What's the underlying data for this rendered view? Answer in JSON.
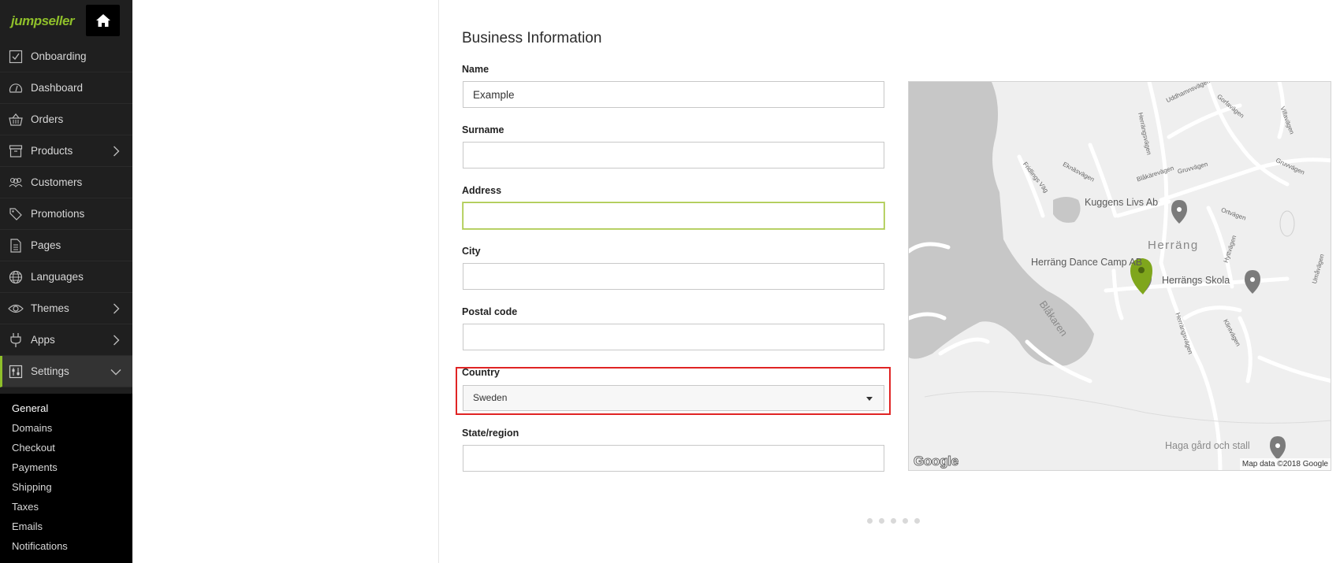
{
  "app": {
    "logo_text": "jumpseller",
    "brand_color": "#8fbf2a"
  },
  "sidebar": {
    "items": [
      {
        "label": "Onboarding",
        "icon": "checkbox-icon",
        "has_children": false
      },
      {
        "label": "Dashboard",
        "icon": "gauge-icon",
        "has_children": false
      },
      {
        "label": "Orders",
        "icon": "basket-icon",
        "has_children": false
      },
      {
        "label": "Products",
        "icon": "box-icon",
        "has_children": true
      },
      {
        "label": "Customers",
        "icon": "people-icon",
        "has_children": false
      },
      {
        "label": "Promotions",
        "icon": "tags-icon",
        "has_children": false
      },
      {
        "label": "Pages",
        "icon": "document-icon",
        "has_children": false
      },
      {
        "label": "Languages",
        "icon": "globe-icon",
        "has_children": false
      },
      {
        "label": "Themes",
        "icon": "eye-icon",
        "has_children": true
      },
      {
        "label": "Apps",
        "icon": "plug-icon",
        "has_children": true
      },
      {
        "label": "Settings",
        "icon": "settings-icon",
        "has_children": true,
        "expanded": true
      }
    ],
    "subitems": [
      "General",
      "Domains",
      "Checkout",
      "Payments",
      "Shipping",
      "Taxes",
      "Emails",
      "Notifications"
    ],
    "current_subitem": "General"
  },
  "form": {
    "title": "Business Information",
    "fields": {
      "name": {
        "label": "Name",
        "value": "Example"
      },
      "surname": {
        "label": "Surname",
        "value": ""
      },
      "address": {
        "label": "Address",
        "value": ""
      },
      "city": {
        "label": "City",
        "value": ""
      },
      "postal_code": {
        "label": "Postal code",
        "value": ""
      },
      "country": {
        "label": "Country",
        "value": "Sweden"
      },
      "state": {
        "label": "State/region",
        "value": ""
      }
    }
  },
  "map": {
    "places": {
      "kuggens": "Kuggens Livs Ab",
      "herrang": "Herräng",
      "dance_camp": "Herräng Dance Camp AB",
      "skola": "Herrängs Skola",
      "haga": "Haga gård och stall",
      "lake": "Blåkaren"
    },
    "roads": {
      "herrangsvagen_top": "Herrängsvägen",
      "herrangsvagen_bottom": "Herrängsvägen",
      "uddhammsvagen": "Uddhamnsvägen",
      "gorfavagen": "Gorfavägen",
      "villavagen": "Villavägen",
      "gruvvagen": "Gruvvägen",
      "gruvvagen2": "Gruvvägen",
      "blakarevagen": "Blåkärevägen",
      "eknasvagen": "Eknäsvägen",
      "fridlings": "Fridlings Väg",
      "ortvagen": "Ortvägen",
      "hyttvagen": "Hyttvägen",
      "klintvagen": "Klintvägen",
      "umavagen": "Umåvägen"
    },
    "google_logo": "Google",
    "attribution": "Map data ©2018 Google",
    "marker_color": "#7fa61c"
  },
  "pager": {
    "count": 5
  }
}
